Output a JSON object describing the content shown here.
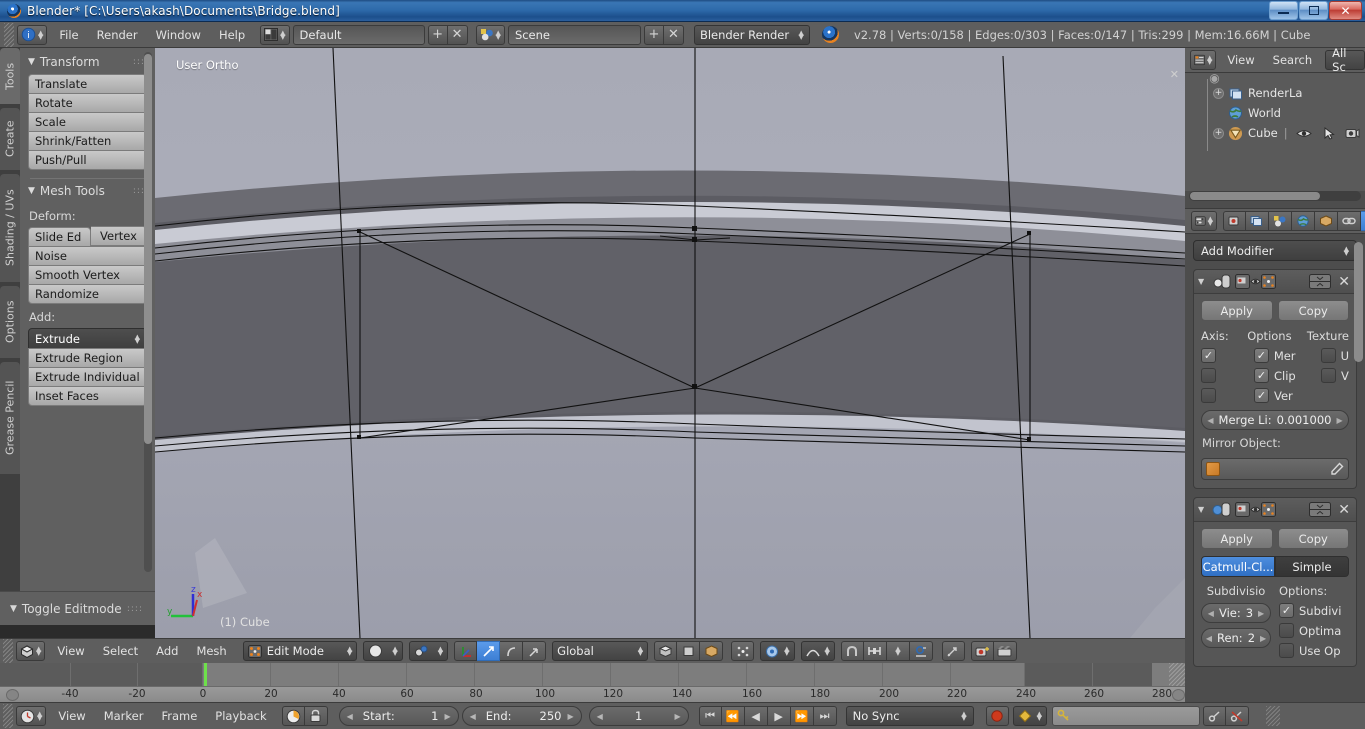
{
  "window": {
    "title": "Blender* [C:\\Users\\akash\\Documents\\Bridge.blend]",
    "minimize": "–",
    "maximize": "❐",
    "close": "✕"
  },
  "topbar": {
    "menus": [
      "File",
      "Render",
      "Window",
      "Help"
    ],
    "screen_layout": "Default",
    "scene_name": "Scene",
    "render_engine": "Blender Render",
    "add_label": "+",
    "remove_label": "✕",
    "stats": "v2.78 | Verts:0/158 | Edges:0/303 | Faces:0/147 | Tris:299 | Mem:16.66M | Cube"
  },
  "toolshelf": {
    "tabs": [
      "Tools",
      "Create",
      "Shading / UVs",
      "Options",
      "Grease Pencil"
    ],
    "active_tab": "Tools",
    "transform": {
      "title": "Transform",
      "buttons": [
        "Translate",
        "Rotate",
        "Scale",
        "Shrink/Fatten",
        "Push/Pull"
      ]
    },
    "mesh_tools": {
      "title": "Mesh Tools",
      "deform_label": "Deform:",
      "deform_split": [
        "Slide Ed",
        "Vertex"
      ],
      "deform_buttons": [
        "Noise",
        "Smooth Vertex",
        "Randomize"
      ],
      "add_label": "Add:",
      "add_dropdown": "Extrude",
      "add_buttons": [
        "Extrude Region",
        "Extrude Individual",
        "Inset Faces"
      ]
    },
    "footer": "Toggle Editmode"
  },
  "viewport": {
    "view_label": "User Ortho",
    "object_label": "(1) Cube",
    "axis_x": "x",
    "axis_y": "y",
    "axis_z": "z"
  },
  "viewport_header": {
    "menus": [
      "View",
      "Select",
      "Add",
      "Mesh"
    ],
    "mode": "Edit Mode",
    "transform_orientation": "Global"
  },
  "timeline": {
    "ticks": [
      -40,
      -20,
      0,
      20,
      40,
      60,
      80,
      100,
      120,
      140,
      160,
      180,
      200,
      220,
      240,
      260,
      280
    ],
    "playhead_frame": 1,
    "range_start": 1,
    "range_end": 250
  },
  "playbar": {
    "menus": [
      "View",
      "Marker",
      "Frame",
      "Playback"
    ],
    "start_label": "Start:",
    "start_value": "1",
    "end_label": "End:",
    "end_value": "250",
    "current_frame": "1",
    "sync_mode": "No Sync",
    "transport": [
      "⏮",
      "⏪",
      "◀",
      "▶",
      "⏩",
      "⏭"
    ]
  },
  "outliner": {
    "view_label": "View",
    "search_label": "Search",
    "display_mode": "All Sc",
    "rows": [
      {
        "label": "RenderLa",
        "icon": "render-layers-icon",
        "expandable": true
      },
      {
        "label": "World",
        "icon": "world-icon",
        "expandable": false
      },
      {
        "label": "Cube",
        "icon": "mesh-triangle-icon",
        "expandable": true
      }
    ]
  },
  "properties": {
    "add_modifier": "Add Modifier",
    "mirror": {
      "apply": "Apply",
      "copy": "Copy",
      "col_axis": "Axis:",
      "col_options": "Options",
      "col_texture": "Texture",
      "axis_checks": [
        true,
        false,
        false
      ],
      "options": [
        {
          "label": "Mer",
          "checked": true
        },
        {
          "label": "Clip",
          "checked": true
        },
        {
          "label": "Ver",
          "checked": true
        }
      ],
      "texture": [
        {
          "label": "U",
          "checked": false
        },
        {
          "label": "V",
          "checked": false
        }
      ],
      "merge_label": "Merge Li:",
      "merge_value": "0.001000",
      "mirror_object_label": "Mirror Object:",
      "mirror_object_value": ""
    },
    "subsurf": {
      "apply": "Apply",
      "copy": "Copy",
      "type_catmull": "Catmull-Cl...",
      "type_simple": "Simple",
      "active_type": "Catmull-Cl...",
      "subdivisions_label": "Subdivisio",
      "view_label": "Vie:",
      "view_value": "3",
      "render_label": "Ren:",
      "render_value": "2",
      "options_label": "Options:",
      "options": [
        {
          "label": "Subdivi",
          "checked": true
        },
        {
          "label": "Optima",
          "checked": false
        },
        {
          "label": "Use Op",
          "checked": false
        }
      ]
    }
  },
  "colors": {
    "accent_blue": "#3d7fd4",
    "playhead_green": "#6ee04a",
    "header_gray": "#5e5e5e",
    "panel_gray": "#4d4d4d",
    "titlebar_blue": "#2d6aaa",
    "orange": "#e8821f"
  }
}
